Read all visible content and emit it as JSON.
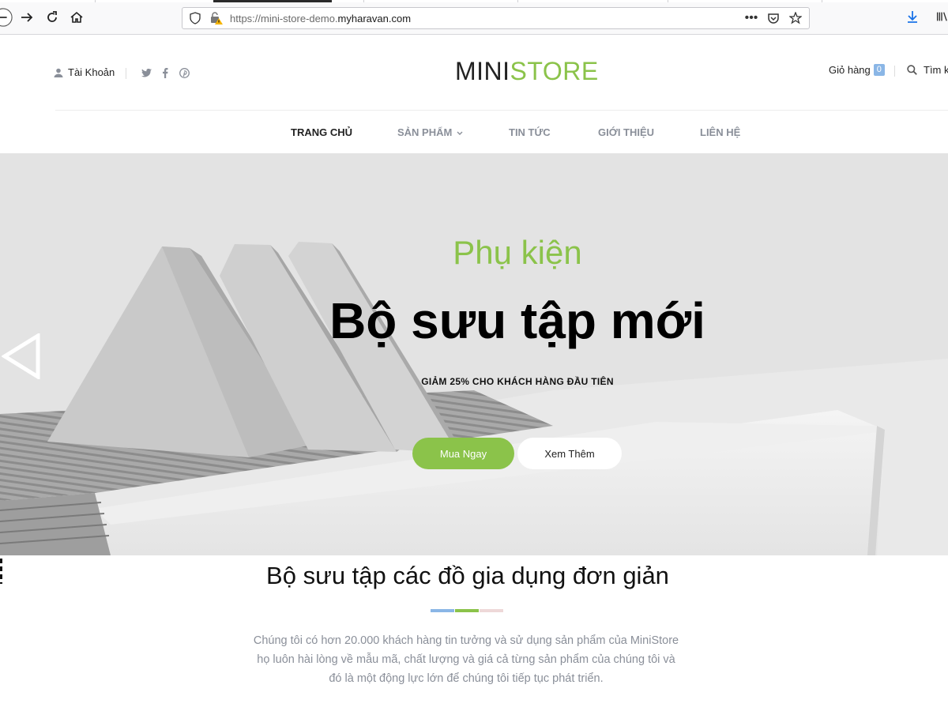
{
  "browser": {
    "url_prefix": "https://mini-store-demo.",
    "url_domain": "myharavan.com",
    "icons": [
      "back-icon",
      "forward-icon",
      "reload-icon",
      "home-icon",
      "shield-icon",
      "insecure-lock-icon",
      "more-icon",
      "pocket-icon",
      "star-icon",
      "download-icon",
      "library-icon"
    ]
  },
  "header": {
    "account_label": "Tài Khoản",
    "logo_mini": "MINI",
    "logo_store": "STORE",
    "cart_label": "Giỏ hàng",
    "cart_count": "0",
    "search_label": "Tìm k"
  },
  "nav": {
    "items": [
      {
        "label": "TRANG CHỦ"
      },
      {
        "label": "SẢN PHẨM"
      },
      {
        "label": "TIN TỨC"
      },
      {
        "label": "GIỚI THIỆU"
      },
      {
        "label": "LIÊN HỆ"
      }
    ]
  },
  "hero": {
    "subtitle": "Phụ kiện",
    "title": "Bộ sưu tập mới",
    "note": "GIẢM 25% CHO KHÁCH HÀNG ĐẦU TIÊN",
    "buy_label": "Mua Ngay",
    "more_label": "Xem Thêm"
  },
  "intro": {
    "title": "Bộ sưu tập các đồ gia dụng đơn giản",
    "line1": "Chúng tôi có hơn 20.000 khách hàng tin tưởng và sử dụng sản phẩm của MiniStore",
    "line2": "họ luôn hài lòng về mẫu mã, chất lượng và giá cả từng sản phẩm của chúng tôi và",
    "line3": "đó là một động lực lớn để chúng tôi tiếp tục phát triển."
  },
  "colors": {
    "accent_green": "#8bc34a",
    "divider_blue": "#8ab6e6",
    "divider_green": "#8bc34a",
    "divider_pink": "#eed8d8"
  }
}
